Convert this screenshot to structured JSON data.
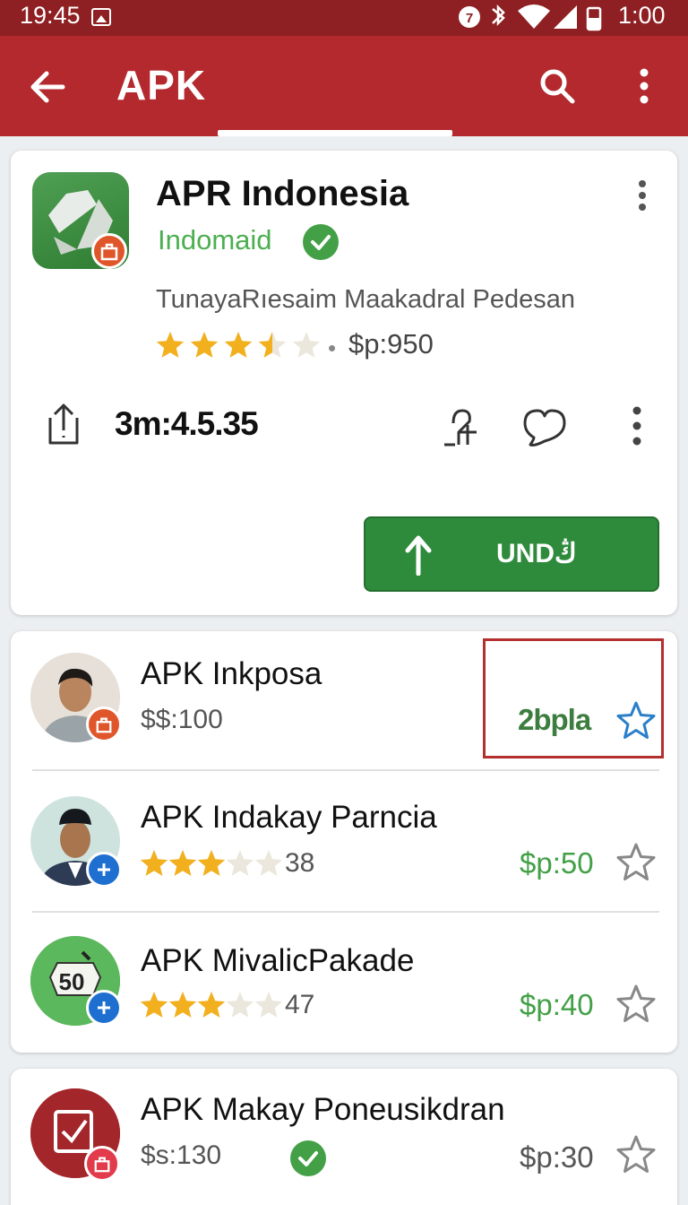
{
  "status_bar": {
    "time": "19:45",
    "right_time": "1:00"
  },
  "app_bar": {
    "title": "APK"
  },
  "featured": {
    "name": "APR Indonesia",
    "developer": "Indomaid",
    "description": "TunayaRıesaim Maakadral Pedesan",
    "rating_stars": 3.5,
    "rating_dot": "•",
    "price": "$p:950",
    "timer": "3m:4.5.35",
    "install_label": "UNDڭ"
  },
  "items": [
    {
      "name": "APK Inkposa",
      "sub": "$$:100",
      "price": "2bplа",
      "highlighted": true,
      "star_color": "#2a7fc9"
    },
    {
      "name": "APK Indakay Parncia",
      "rating_stars": 3,
      "count": "38",
      "price": "$p:50"
    },
    {
      "name": "APK MivalicPakade",
      "rating_stars": 3,
      "count": "47",
      "price": "$p:40",
      "icon_text": "50"
    },
    {
      "name": "APK Makay Poneusikdran",
      "sub": "$s:130",
      "price": "$p:30"
    }
  ],
  "colors": {
    "app_bar": "#b3292e",
    "status_bar": "#8e1f22",
    "accent_green": "#2e8b3c",
    "star_gold": "#f2b01e"
  }
}
